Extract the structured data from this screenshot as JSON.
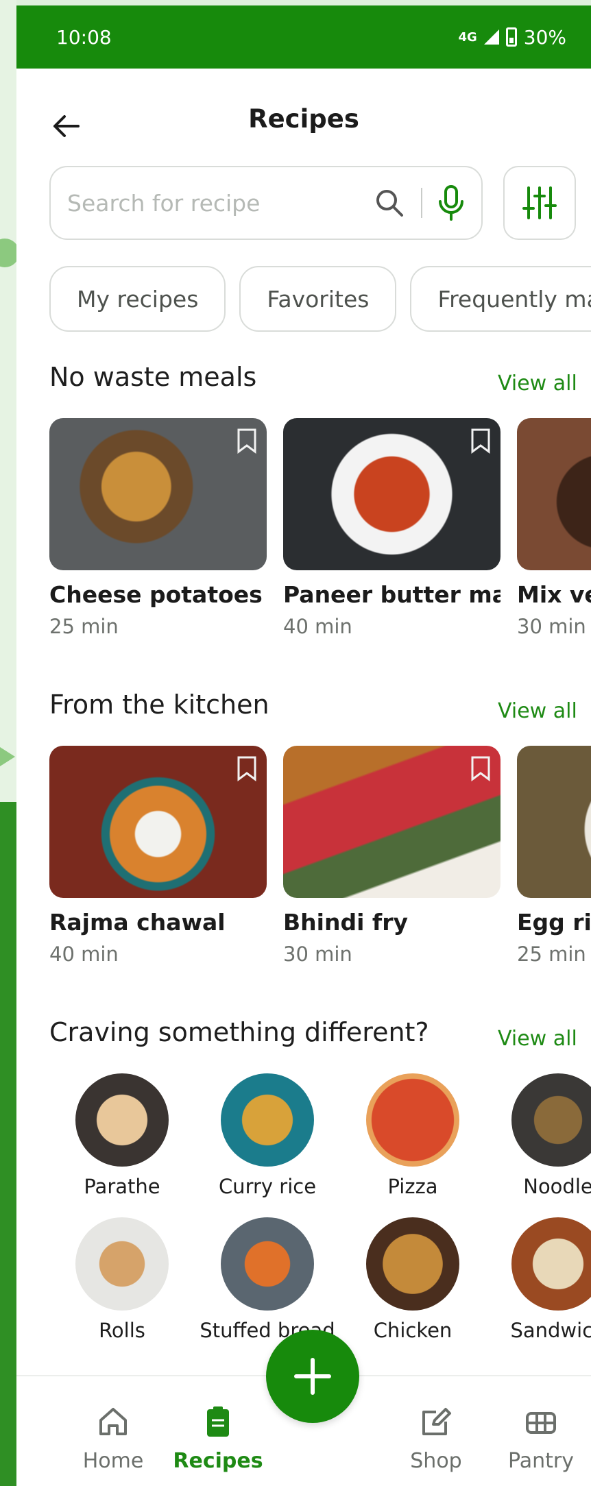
{
  "status_bar": {
    "time": "10:08",
    "network": "4G",
    "battery": "30%"
  },
  "header": {
    "title": "Recipes"
  },
  "search": {
    "placeholder": "Search for recipe"
  },
  "chips": [
    "My recipes",
    "Favorites",
    "Frequently made"
  ],
  "sections": [
    {
      "title": "No waste meals",
      "view_all": "View all",
      "cards": [
        {
          "name": "Cheese potatoes",
          "time": "25 min"
        },
        {
          "name": "Paneer butter ma..",
          "time": "40 min"
        },
        {
          "name": "Mix veg",
          "time": "30 min"
        }
      ]
    },
    {
      "title": "From the kitchen",
      "view_all": "View all",
      "cards": [
        {
          "name": "Rajma chawal",
          "time": "40 min"
        },
        {
          "name": "Bhindi fry",
          "time": "30 min"
        },
        {
          "name": "Egg rice",
          "time": "25 min"
        }
      ]
    },
    {
      "title": "Craving something different?",
      "view_all": "View all"
    }
  ],
  "categories": [
    "Parathe",
    "Curry rice",
    "Pizza",
    "Noodle",
    "Rolls",
    "Stuffed bread",
    "Chicken",
    "Sandwich"
  ],
  "bottom_nav": [
    {
      "label": "Home",
      "icon": "home-icon"
    },
    {
      "label": "Recipes",
      "icon": "clipboard-icon",
      "active": true
    },
    {
      "label": "Shop",
      "icon": "edit-icon"
    },
    {
      "label": "Pantry",
      "icon": "pantry-icon"
    }
  ],
  "colors": {
    "accent": "#178a0c",
    "link": "#1e8a14"
  }
}
